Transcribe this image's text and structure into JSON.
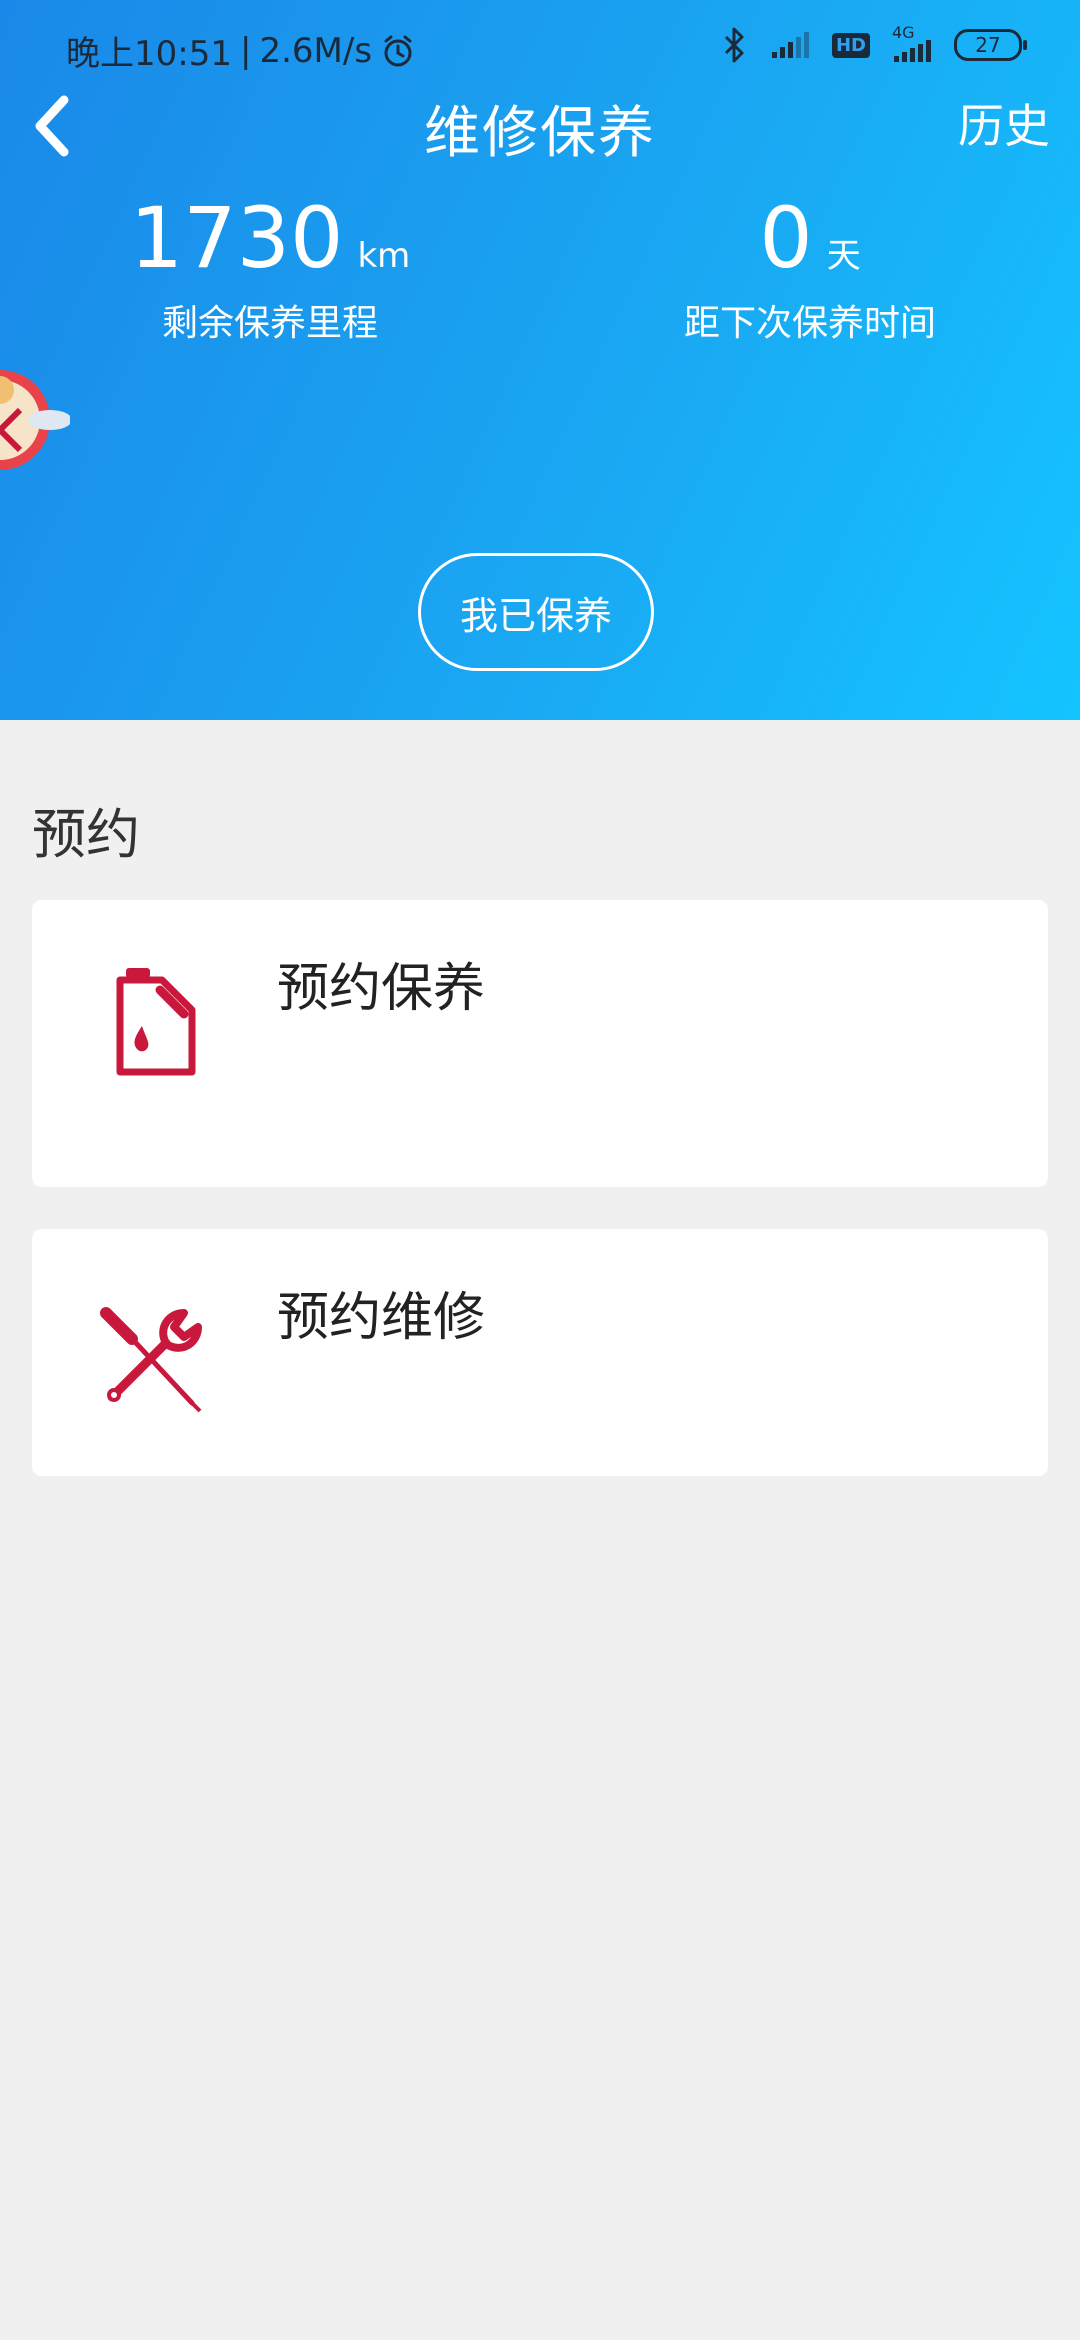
{
  "status_bar": {
    "time": "晚上10:51",
    "separator": "|",
    "speed": "2.6M/s",
    "hd": "HD",
    "net": "4G",
    "battery": "27",
    "icons": [
      "alarm-icon",
      "bluetooth-icon",
      "signal-icon",
      "signal-4g-icon"
    ]
  },
  "nav": {
    "title": "维修保养",
    "history": "历史",
    "back_icon": "chevron-left-icon"
  },
  "stats": {
    "mileage": {
      "value": "1730",
      "unit": "km",
      "label": "剩余保养里程"
    },
    "days": {
      "value": "0",
      "unit": "天",
      "label": "距下次保养时间"
    }
  },
  "maintained_button": "我已保养",
  "section": {
    "title": "预约",
    "cards": [
      {
        "label": "预约保养",
        "icon": "oil-can-icon"
      },
      {
        "label": "预约维修",
        "icon": "wrench-screwdriver-icon"
      }
    ]
  },
  "colors": {
    "header_gradient_start": "#1a88e8",
    "header_gradient_end": "#14c4ff",
    "icon_red": "#c8193c",
    "page_bg": "#f0f0f0"
  }
}
